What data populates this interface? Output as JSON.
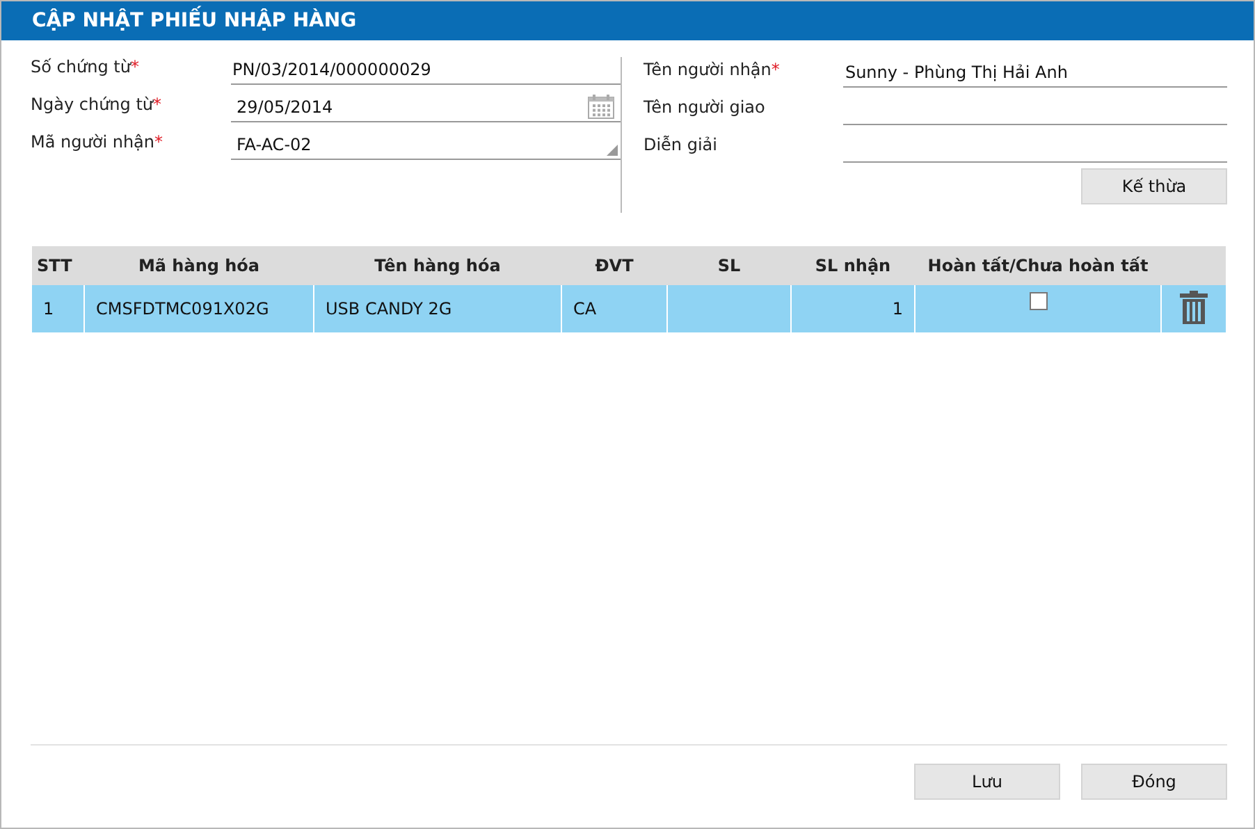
{
  "window": {
    "title": "CẬP NHẬT PHIẾU NHẬP HÀNG"
  },
  "left_fields": [
    {
      "label": "Số chứng từ",
      "mark": "*",
      "kind": "text",
      "value": "PN/03/2014/000000029"
    },
    {
      "label": "Ngày chứng từ",
      "mark": "*",
      "kind": "date",
      "value": "29/05/2014"
    },
    {
      "label": "Mã người nhận",
      "mark": "*",
      "kind": "select",
      "value": "FA-AC-02"
    }
  ],
  "right_fields": [
    {
      "label": "Tên người nhận",
      "mark": "*",
      "kind": "text",
      "value": "Sunny - Phùng Thị Hải Anh"
    },
    {
      "label": "Tên người giao",
      "kind": "text"
    },
    {
      "label": "Diễn giải",
      "kind": "text"
    }
  ],
  "inherit_button": "Kế thừa",
  "table": {
    "columns": [
      "STT",
      "Mã hàng hóa",
      "Tên hàng hóa",
      "ĐVT",
      "SL",
      "SL nhận",
      "Hoàn tất/Chưa hoàn tất"
    ],
    "rows": [
      {
        "cells": [
          "1",
          "CMSFDTMC091X02G",
          "USB CANDY 2G",
          "CA",
          "",
          "1"
        ],
        "done": false,
        "selected": true
      }
    ]
  },
  "buttons": [
    "Lưu",
    "Đóng"
  ]
}
